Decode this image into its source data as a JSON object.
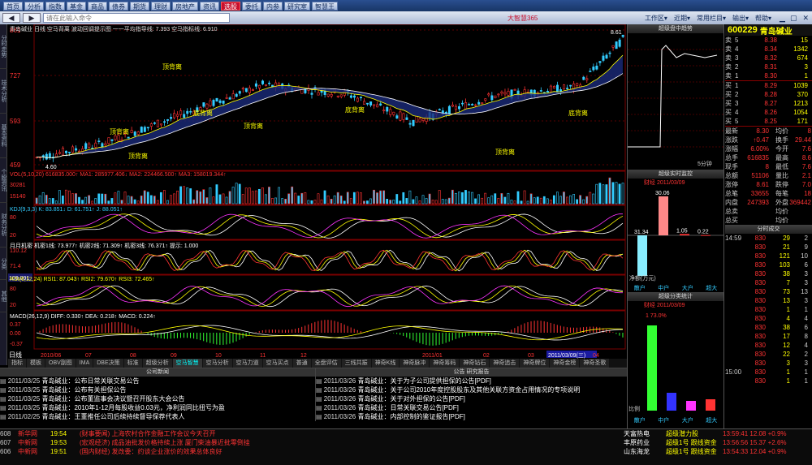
{
  "top_menu": [
    "首页",
    "分析",
    "指数",
    "基金",
    "商品",
    "债券",
    "期货",
    "理财",
    "房地产",
    "资讯",
    "选股",
    "委托",
    "内参",
    "研究室",
    "智慧王"
  ],
  "search_placeholder": "请在此输入命令",
  "right_menu": [
    "工作区",
    "近期",
    "常用栏目",
    "输出",
    "帮助"
  ],
  "logo_text": "大智慧365",
  "left_tabs": [
    "分时走势",
    "技术分析",
    "基本资料",
    "个股资讯",
    "财务分析",
    "分类",
    "其他"
  ],
  "chart": {
    "header": "青岛碱业 日线  空马背离  波动回调提示图  一一平均指导线: 7.393  空马指标线: 6.910",
    "y_labels": [
      "861",
      "727",
      "593",
      "459"
    ],
    "max_label": "8.61",
    "min_label": "4.60",
    "labels_bottom_price": [
      "顶背离",
      "顶背离",
      "顶背离",
      "底背离",
      "顶背离",
      "底背离",
      "顶背离",
      "底背离"
    ]
  },
  "vol_panel": {
    "header": "VOL(5,10,20) 616835.000↑  MA1: 285977.406↓  MA2: 224466.500↑  MA3: 158019.344↑",
    "y": [
      "30281",
      "15140"
    ]
  },
  "kdj_panel": {
    "header": "KDJ(9,3,3)  K: 83.851↓  D: 61.751↑  J: 88.051↑",
    "y": [
      "80",
      "20"
    ]
  },
  "ma_panel": {
    "header": "月月机密  机密1线: 73.977↑  机密2线: 71.309↑  机密3线: 76.371↑  提示: 1.000",
    "y": [
      "110.12",
      "109.091",
      "71.4"
    ]
  },
  "rsi_panel": {
    "header": "RSI(6,12,24)  RSI1: 87.043↑  RSI2: 79.670↑  RSI3: 72.465↑",
    "y": [
      "80",
      "20"
    ]
  },
  "macd_panel": {
    "header": "MACD(26,12,9)  DIFF: 0.330↑  DEA: 0.218↑  MACD: 0.224↑",
    "y": [
      "0.37",
      "0.00",
      "-0.37"
    ]
  },
  "axis": {
    "label": "日线",
    "dates": [
      "2010/06",
      "07",
      "08",
      "09",
      "10",
      "11",
      "12",
      "2011/01",
      "02",
      "03",
      "2011/03/09(三)",
      "04"
    ]
  },
  "bottom_tabs": [
    "指标",
    "模板",
    "OBV副图",
    "IMA",
    "DBE决策",
    "标准",
    "超级分析",
    "空马智慧",
    "空马分析",
    "空马力道",
    "空马买点",
    "普通",
    "全盘评估",
    "三线共振",
    "神奇K线",
    "神奇脉冲",
    "神奇筹码",
    "神奇钻石",
    "神奇追击",
    "神奇牌位",
    "神奇金榜",
    "神奇圣歌"
  ],
  "news_left_title": "公司新闻",
  "news_right_title": "公告 研究报告",
  "news_left": [
    {
      "date": "2011/03/25",
      "text": "青岛碱业：公布日常关联交易公告"
    },
    {
      "date": "2011/03/25",
      "text": "青岛碱业：公布有关担保公告"
    },
    {
      "date": "2011/03/25",
      "text": "青岛碱业：公布董监事会决议暨召开股东大会公告"
    },
    {
      "date": "2011/03/25",
      "text": "青岛碱业：2010年1-12月每股收益0.03元，净利润同比扭亏为盈"
    },
    {
      "date": "2011/02/25",
      "text": "青岛碱业：王董推任公司后续持续督导保荐代表人"
    }
  ],
  "news_right": [
    {
      "date": "2011/03/26",
      "text": "青岛碱业：关于为子公司提供担保的公告[PDF]"
    },
    {
      "date": "2011/03/26",
      "text": "青岛碱业：关于公司2010年度控股股东及其他关联方资金占用情况的专项说明"
    },
    {
      "date": "2011/03/26",
      "text": "青岛碱业：关于对外担保的公告[PDF]"
    },
    {
      "date": "2011/03/26",
      "text": "青岛碱业：日常关联交易公告[PDF]"
    },
    {
      "date": "2011/03/26",
      "text": "青岛碱业：内部控制的鉴证报告[PDF]"
    }
  ],
  "mid": {
    "title1": "超级盘中趋势",
    "title2": "超级实时监控",
    "title2_sub": "财经 2011/03/09",
    "bar_labels": [
      "31.34",
      "30.06",
      "1.05",
      "0.22"
    ],
    "axis_label": "净额(万元)",
    "cats": [
      "散户",
      "中户",
      "大户",
      "超大"
    ],
    "title3": "超级分类统计",
    "title3_sub": "财经 2011/03/09",
    "pct": "1 73.0%",
    "cats2": [
      "散户",
      "中户",
      "大户",
      "超大"
    ],
    "ratio_label": "比例",
    "end_label": "5分钟"
  },
  "quote": {
    "code": "600229",
    "name": "青岛碱业",
    "sell": [
      {
        "lvl": "5",
        "price": "8.38",
        "vol": "15"
      },
      {
        "lvl": "4",
        "price": "8.34",
        "vol": "1342"
      },
      {
        "lvl": "3",
        "price": "8.32",
        "vol": "674"
      },
      {
        "lvl": "2",
        "price": "8.31",
        "vol": "3"
      },
      {
        "lvl": "1",
        "price": "8.30",
        "vol": "1"
      }
    ],
    "buy": [
      {
        "lvl": "1",
        "price": "8.29",
        "vol": "1039"
      },
      {
        "lvl": "2",
        "price": "8.28",
        "vol": "370"
      },
      {
        "lvl": "3",
        "price": "8.27",
        "vol": "1213"
      },
      {
        "lvl": "4",
        "price": "8.26",
        "vol": "1054"
      },
      {
        "lvl": "5",
        "price": "8.25",
        "vol": "171"
      }
    ],
    "stats": [
      [
        "最新",
        "8.30",
        "均价",
        "8"
      ],
      [
        "涨跌",
        "↑0.47",
        "换手",
        "29.44"
      ],
      [
        "涨幅",
        "6.00%",
        "今开",
        "7.6"
      ],
      [
        "总手",
        "616835",
        "最高",
        "8.6"
      ],
      [
        "现手",
        "8",
        "最低",
        "7.6"
      ],
      [
        "总额",
        "51106",
        "量比",
        "2.1"
      ],
      [
        "涨停",
        "8.61",
        "跌停",
        "7.0"
      ],
      [
        "总笔",
        "33655",
        "每笔",
        "18"
      ],
      [
        "内盘",
        "247393",
        "外盘",
        "369442"
      ],
      [
        "总卖",
        "",
        "均价",
        ""
      ],
      [
        "总买",
        "",
        "均价",
        ""
      ]
    ],
    "ticks_title": "分时成交",
    "ticks": [
      [
        "14:59",
        "830",
        "29",
        "2"
      ],
      [
        "",
        "830",
        "21",
        "9"
      ],
      [
        "",
        "830",
        "121",
        "10"
      ],
      [
        "",
        "830",
        "103",
        "6"
      ],
      [
        "",
        "830",
        "38",
        "3"
      ],
      [
        "",
        "830",
        "7",
        "3"
      ],
      [
        "",
        "830",
        "73",
        "13"
      ],
      [
        "",
        "830",
        "13",
        "3"
      ],
      [
        "",
        "830",
        "1",
        "1"
      ],
      [
        "",
        "830",
        "4",
        "4"
      ],
      [
        "",
        "830",
        "38",
        "6"
      ],
      [
        "",
        "830",
        "17",
        "8"
      ],
      [
        "",
        "830",
        "12",
        "4"
      ],
      [
        "",
        "830",
        "22",
        "2"
      ],
      [
        "",
        "830",
        "3",
        "3"
      ],
      [
        "15:00",
        "830",
        "1",
        "1"
      ],
      [
        "",
        "830",
        "1",
        "1"
      ]
    ]
  },
  "ticker": [
    {
      "n": "608",
      "src": "新华网",
      "t": "19:54",
      "msg": "(财事要闻) 上海农村合作金融工作会议今天召开",
      "s2": "天富热电",
      "s2b": "超级潜力股",
      "s3": "13:59:41 12.08 +0.9%"
    },
    {
      "n": "607",
      "src": "中新网",
      "t": "19:53",
      "msg": "(宏观经济) 成品油批发价格持续上涨 厦门柴油暴近批零倒挂",
      "s2": "丰原药业",
      "s2b": "超级1号 跟线资金",
      "s3": "13:56:56 15.37 +2.6%"
    },
    {
      "n": "606",
      "src": "中新网",
      "t": "19:51",
      "msg": "(国内财经) 发改委：约谈企业涨价的效果总体良好",
      "s2": "山东海龙",
      "s2b": "超级1号 跟线资金",
      "s3": "13:54:33 12.04 +0.9%"
    }
  ]
}
